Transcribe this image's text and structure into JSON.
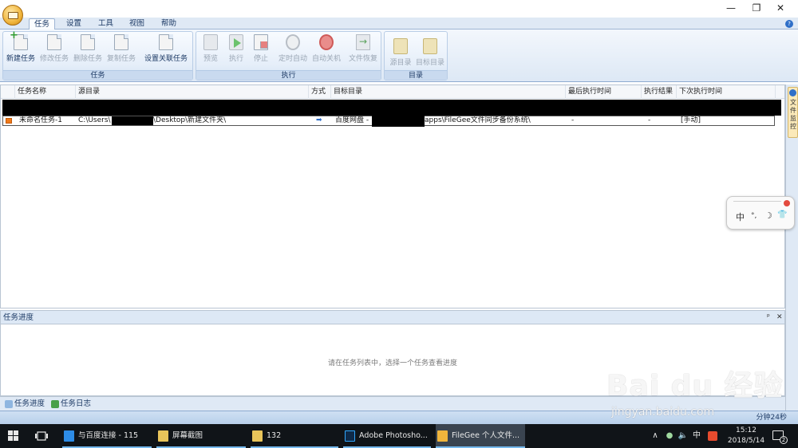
{
  "window": {
    "controls": {
      "minimize": "—",
      "maximize": "❐",
      "close": "✕"
    }
  },
  "ribbon": {
    "tabs": [
      {
        "label": "任务",
        "active": true
      },
      {
        "label": "设置",
        "active": false
      },
      {
        "label": "工具",
        "active": false
      },
      {
        "label": "视图",
        "active": false
      },
      {
        "label": "帮助",
        "active": false
      }
    ],
    "groups": {
      "task": {
        "label": "任务",
        "buttons": {
          "new": "新建任务",
          "edit": "修改任务",
          "delete": "删除任务",
          "copy": "复制任务",
          "link": "设置关联任务"
        }
      },
      "execute": {
        "label": "执行",
        "buttons": {
          "preview": "预览",
          "run": "执行",
          "stop": "停止",
          "schedule": "定时自动",
          "shutdown": "自动关机",
          "restore": "文件恢复"
        }
      },
      "directory": {
        "label": "目录",
        "buttons": {
          "source": "源目录",
          "target": "目标目录"
        }
      }
    }
  },
  "tasklist": {
    "columns": [
      "任务名称",
      "源目录",
      "方式",
      "目标目录",
      "最后执行时间",
      "执行结果",
      "下次执行时间"
    ],
    "rows": [
      {
        "name": "未命名任务-1",
        "source_prefix": "C:\\Users\\",
        "source_suffix": "\\Desktop\\新建文件夹\\",
        "mode": "➡",
        "target_prefix": "百度网盘 - ",
        "target_suffix": "apps\\FileGee文件同步备份系统\\",
        "last_run": "-",
        "result": "-",
        "next_run": "[手动]"
      }
    ]
  },
  "side_dock": {
    "tab_label": "文件监控"
  },
  "ime": {
    "mode": "中",
    "punct": "°,",
    "moon": "☽",
    "shirt": "👕"
  },
  "progress_panel": {
    "title": "任务进度",
    "pin": "ᵖ",
    "close": "✕",
    "message": "请在任务列表中，选择一个任务查看进度"
  },
  "panel_tabs": [
    {
      "label": "任务进度"
    },
    {
      "label": "任务日志"
    }
  ],
  "statusbar": {
    "text": "分钟24秒"
  },
  "watermark": {
    "logo": "Bai du 经验",
    "url": "jingyan.baidu.com"
  },
  "taskbar": {
    "apps": [
      {
        "label": "与百度连接 - 115"
      },
      {
        "label": "屏幕截图"
      },
      {
        "label": "132"
      },
      {
        "label": "Adobe Photosho..."
      },
      {
        "label": "FileGee 个人文件..."
      }
    ],
    "tray": {
      "up": "∧",
      "ime": "中",
      "time": "15:12",
      "date": "2018/5/14",
      "notifications": "2"
    }
  }
}
